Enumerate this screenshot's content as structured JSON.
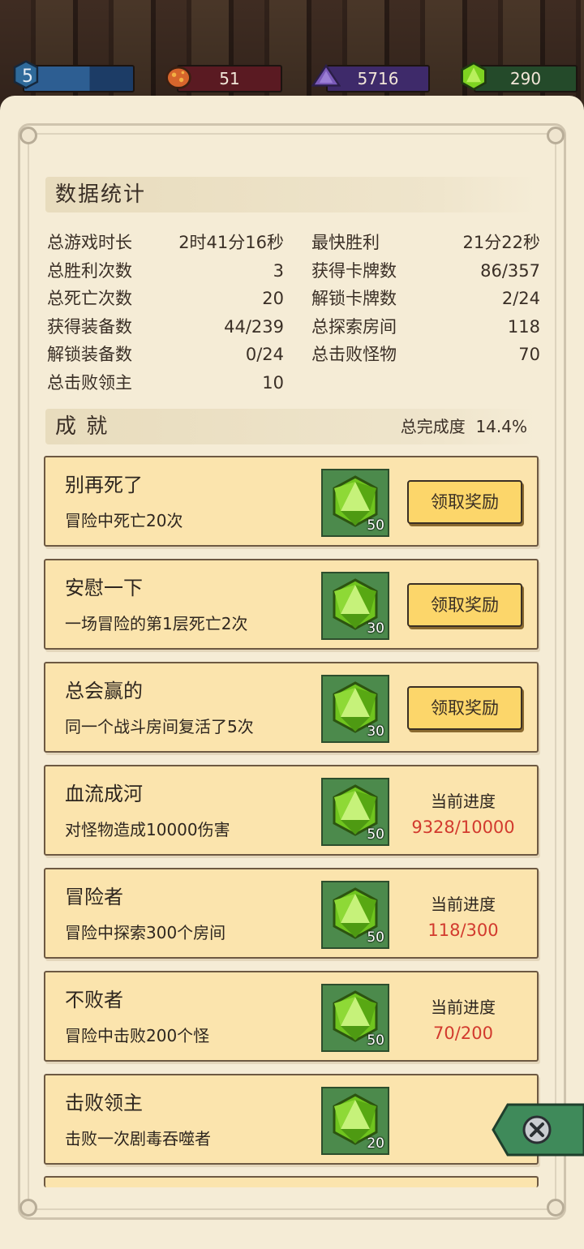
{
  "hud": {
    "level": "5",
    "gems_red": "51",
    "gems_purple": "5716",
    "gems_green": "290"
  },
  "stats_section": {
    "title": "数据统计"
  },
  "stats": [
    {
      "label": "总游戏时长",
      "value": "2时41分16秒"
    },
    {
      "label": "最快胜利",
      "value": "21分22秒"
    },
    {
      "label": "总胜利次数",
      "value": "3"
    },
    {
      "label": "获得卡牌数",
      "value": "86/357"
    },
    {
      "label": "总死亡次数",
      "value": "20"
    },
    {
      "label": "解锁卡牌数",
      "value": "2/24"
    },
    {
      "label": "获得装备数",
      "value": "44/239"
    },
    {
      "label": "总探索房间",
      "value": "118"
    },
    {
      "label": "解锁装备数",
      "value": "0/24"
    },
    {
      "label": "总击败怪物",
      "value": "70"
    },
    {
      "label": "总击败领主",
      "value": "10"
    }
  ],
  "achievements_section": {
    "title": "成 就",
    "completion_label": "总完成度",
    "completion_value": "14.4%"
  },
  "achievements": [
    {
      "name": "别再死了",
      "desc": "冒险中死亡20次",
      "reward": "50",
      "claim": "领取奖励"
    },
    {
      "name": "安慰一下",
      "desc": "一场冒险的第1层死亡2次",
      "reward": "30",
      "claim": "领取奖励"
    },
    {
      "name": "总会赢的",
      "desc": "同一个战斗房间复活了5次",
      "reward": "30",
      "claim": "领取奖励"
    },
    {
      "name": "血流成河",
      "desc": "对怪物造成10000伤害",
      "reward": "50",
      "progress_label": "当前进度",
      "progress": "9328/10000"
    },
    {
      "name": "冒险者",
      "desc": "冒险中探索300个房间",
      "reward": "50",
      "progress_label": "当前进度",
      "progress": "118/300"
    },
    {
      "name": "不败者",
      "desc": "冒险中击败200个怪",
      "reward": "50",
      "progress_label": "当前进度",
      "progress": "70/200"
    },
    {
      "name": "击败领主",
      "desc": "击败一次剧毒吞噬者",
      "reward": "20"
    }
  ],
  "colors": {
    "paper": "#f5ecd6",
    "card": "#fbe4ad",
    "button": "#fcd66a",
    "progress_text": "#d23a2e",
    "reward_bg": "#4c8a4c"
  }
}
